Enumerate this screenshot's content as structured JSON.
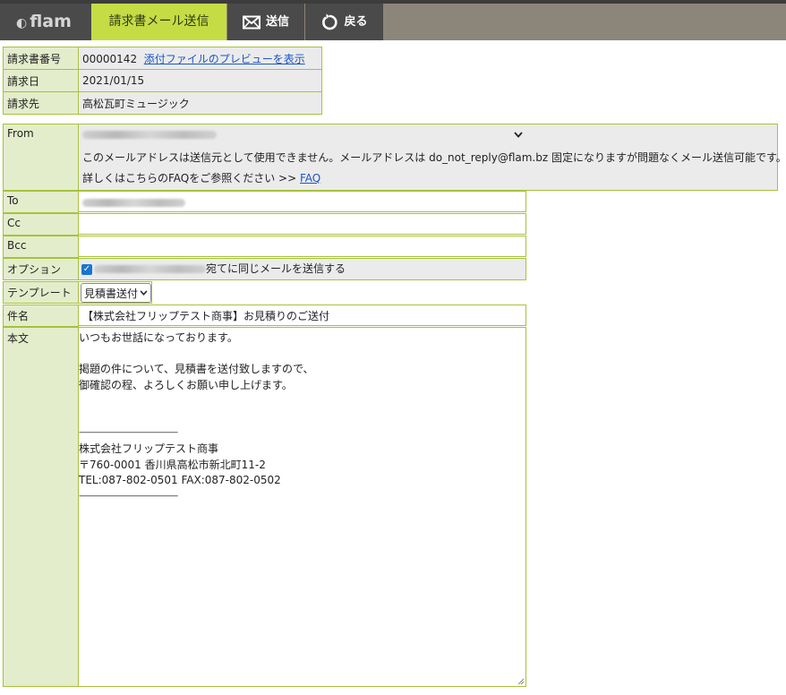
{
  "app": {
    "logo_text": "flam"
  },
  "header": {
    "active_tab_label": "請求書メール送信",
    "send_label": "送信",
    "back_label": "戻る"
  },
  "invoice": {
    "number_label": "請求書番号",
    "number_value": "00000142",
    "preview_link": "添付ファイルのプレビューを表示",
    "date_label": "請求日",
    "date_value": "2021/01/15",
    "recipient_label": "請求先",
    "recipient_value": "高松瓦町ミュージック"
  },
  "form": {
    "from_label": "From",
    "from_notice": "このメールアドレスは送信元として使用できません。メールアドレスは do_not_reply@flam.bz 固定になりますが問題なくメール送信可能です。",
    "from_faq_text": "詳しくはこちらのFAQをご参照ください >>",
    "from_faq_link": "FAQ",
    "to_label": "To",
    "cc_label": "Cc",
    "bcc_label": "Bcc",
    "option_label": "オプション",
    "option_text": "宛てに同じメールを送信する",
    "option_checked": true,
    "template_label": "テンプレート",
    "template_value": "見積書送付",
    "subject_label": "件名",
    "subject_value": "【株式会社フリップテスト商事】お見積りのご送付",
    "body_label": "本文",
    "body_lines": [
      "いつもお世話になっております。",
      "",
      "掲題の件について、見積書を送付致しますので、",
      "御確認の程、よろしくお願い申し上げます。",
      "",
      "",
      "-------------------------------------------------",
      "株式会社フリップテスト商事",
      "〒760-0001 香川県高松市新北町11-2",
      "TEL:087-802-0501 FAX:087-802-0502",
      "-------------------------------------------------"
    ]
  },
  "colors": {
    "accent": "#c6dc45",
    "label_bg": "#e4edcb",
    "border": "#a6c23a",
    "topbar": "#8c857a",
    "dark_button": "#4a4a4a",
    "link": "#1a56c9"
  }
}
